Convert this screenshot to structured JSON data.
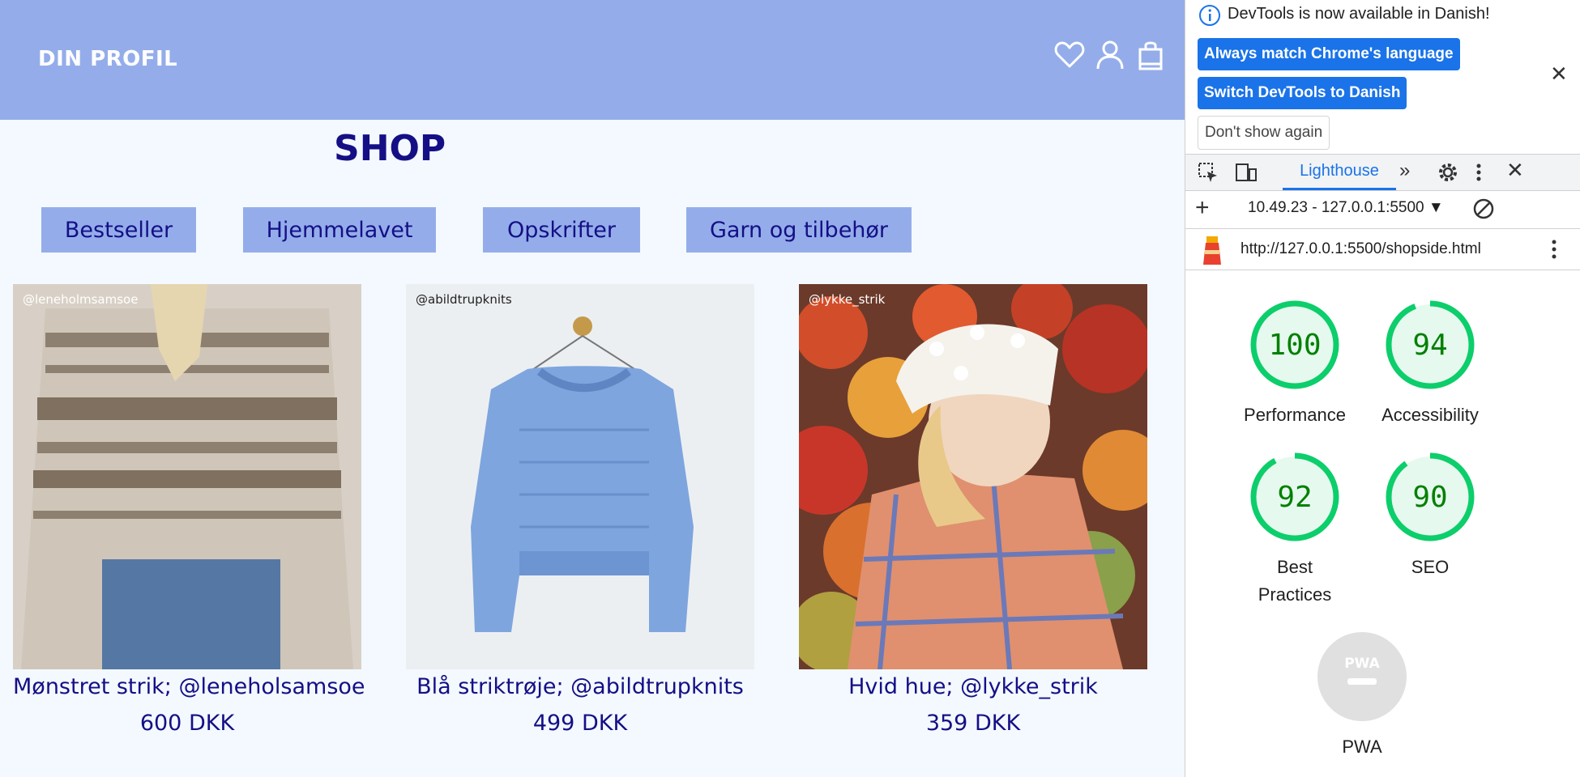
{
  "site": {
    "profile_label": "DIN PROFIL",
    "shop_title": "SHOP",
    "categories": [
      "Bestseller",
      "Hjemmelavet",
      "Opskrifter",
      "Garn og tilbehør"
    ],
    "products": [
      {
        "name": "Mønstret strik; @leneholsamsoe",
        "price": "600 DKK",
        "credit": "@leneholmsamsoe"
      },
      {
        "name": "Blå striktrøje; @abildtrupknits",
        "price": "499 DKK",
        "credit": "@abildtrupknits"
      },
      {
        "name": "Hvid hue; @lykke_strik",
        "price": "359 DKK",
        "credit": "@lykke_strik"
      }
    ],
    "colors": {
      "header": "#94adea",
      "text": "#150f86",
      "page_bg": "#f3f9fe"
    }
  },
  "devtools": {
    "banner": {
      "message": "DevTools is now available in Danish!",
      "match_button": "Always match Chrome's language",
      "switch_button": "Switch DevTools to Danish",
      "dont_show_button": "Don't show again"
    },
    "active_tab": "Lighthouse",
    "report_select": "10.49.23 - 127.0.0.1:5500",
    "report_url": "http://127.0.0.1:5500/shopside.html",
    "scores": [
      {
        "value": "100",
        "label": "Performance"
      },
      {
        "value": "94",
        "label": "Accessibility"
      },
      {
        "value": "92",
        "label": "Best Practices"
      },
      {
        "value": "90",
        "label": "SEO"
      }
    ],
    "pwa": {
      "badge": "PWA",
      "label": "PWA"
    },
    "colors": {
      "pass": "#0cce6b",
      "pass_text": "#008000",
      "accent": "#1a73e8"
    }
  }
}
